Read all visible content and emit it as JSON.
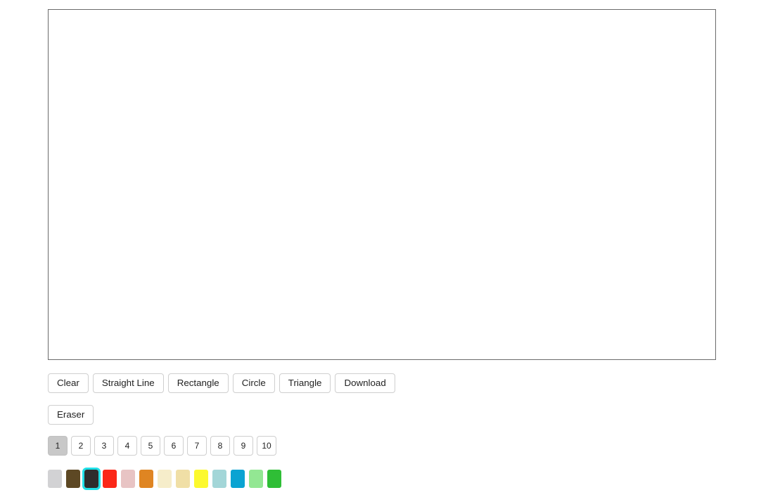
{
  "canvas": {
    "name": "drawing-canvas",
    "background": "#ffffff",
    "border_color": "#6b6b6b",
    "content": ""
  },
  "tools": {
    "primary": [
      {
        "id": "clear",
        "label": "Clear"
      },
      {
        "id": "straight-line",
        "label": "Straight Line"
      },
      {
        "id": "rectangle",
        "label": "Rectangle"
      },
      {
        "id": "circle",
        "label": "Circle"
      },
      {
        "id": "triangle",
        "label": "Triangle"
      },
      {
        "id": "download",
        "label": "Download"
      }
    ],
    "secondary": [
      {
        "id": "eraser",
        "label": "Eraser"
      }
    ]
  },
  "brush_sizes": {
    "selected": "1",
    "selected_background": "#c8c8c8",
    "options": [
      {
        "value": "1",
        "label": "1"
      },
      {
        "value": "2",
        "label": "2"
      },
      {
        "value": "3",
        "label": "3"
      },
      {
        "value": "4",
        "label": "4"
      },
      {
        "value": "5",
        "label": "5"
      },
      {
        "value": "6",
        "label": "6"
      },
      {
        "value": "7",
        "label": "7"
      },
      {
        "value": "8",
        "label": "8"
      },
      {
        "value": "9",
        "label": "9"
      },
      {
        "value": "10",
        "label": "10"
      }
    ]
  },
  "palette": {
    "selected_index": 2,
    "selection_outline": "#1fe0e8",
    "swatches": [
      {
        "name": "light-gray",
        "hex": "#d2d2d4"
      },
      {
        "name": "dark-brown",
        "hex": "#5d4824"
      },
      {
        "name": "near-black",
        "hex": "#2e2c2c"
      },
      {
        "name": "red",
        "hex": "#fb2718"
      },
      {
        "name": "dusty-pink",
        "hex": "#e8c4c4"
      },
      {
        "name": "orange",
        "hex": "#df8522"
      },
      {
        "name": "ivory",
        "hex": "#f6edca"
      },
      {
        "name": "wheat",
        "hex": "#f0dfa6"
      },
      {
        "name": "yellow",
        "hex": "#fcf92e"
      },
      {
        "name": "pale-aqua",
        "hex": "#a3d6d8"
      },
      {
        "name": "azure-blue",
        "hex": "#0aa3d2"
      },
      {
        "name": "light-green",
        "hex": "#93e793"
      },
      {
        "name": "green",
        "hex": "#2fbe36"
      }
    ]
  }
}
